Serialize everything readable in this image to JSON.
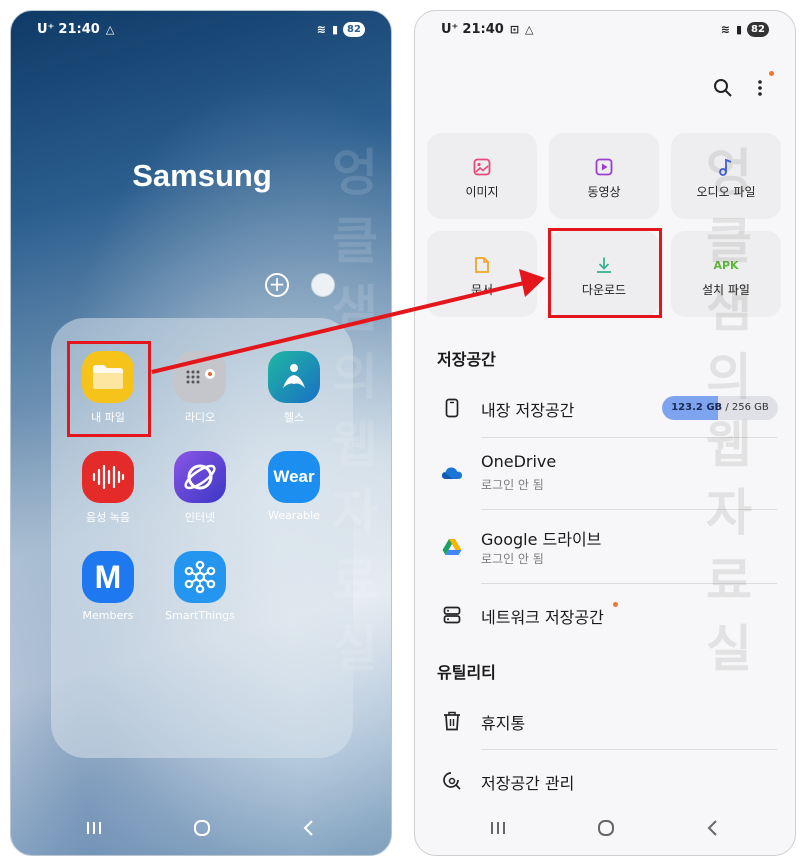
{
  "home": {
    "status": {
      "carrier": "U⁺",
      "time": "21:40",
      "battery": "82"
    },
    "brand": "Samsung",
    "apps": [
      {
        "label": "내 파일",
        "icon": "folder-icon"
      },
      {
        "label": "라디오",
        "icon": "radio-icon"
      },
      {
        "label": "헬스",
        "icon": "health-icon"
      },
      {
        "label": "음성 녹음",
        "icon": "voice-recorder-icon"
      },
      {
        "label": "인터넷",
        "icon": "internet-icon"
      },
      {
        "label": "Wearable",
        "icon": "wearable-icon",
        "glyph": "Wear"
      },
      {
        "label": "Members",
        "icon": "members-icon",
        "glyph": "M"
      },
      {
        "label": "SmartThings",
        "icon": "smartthings-icon"
      }
    ],
    "colors": {
      "highlight": "#e4161b",
      "folder_app": "#f6c31b",
      "radio_app": "#c4c6cc",
      "health_app": "#1fa6a8",
      "voice_app": "#e52a2a",
      "internet_app": "#6a4bd8",
      "wear_app": "#1c8ef0",
      "members_app": "#1e78f0",
      "smartthings_app": "#2496f0"
    }
  },
  "files": {
    "status": {
      "carrier": "U⁺",
      "time": "21:40",
      "battery": "82"
    },
    "categories": [
      {
        "label": "이미지",
        "icon": "image-icon",
        "color": "#e64a7b"
      },
      {
        "label": "동영상",
        "icon": "video-icon",
        "color": "#9b3fd2"
      },
      {
        "label": "오디오 파일",
        "icon": "music-icon",
        "color": "#3f5fd6"
      },
      {
        "label": "문서",
        "icon": "document-icon",
        "color": "#f0a621"
      },
      {
        "label": "다운로드",
        "icon": "download-icon",
        "color": "#33b38f"
      },
      {
        "label": "설치 파일",
        "icon": "apk-icon",
        "glyph": "APK",
        "color": "#5cb83a"
      }
    ],
    "storage_section": "저장공간",
    "storage": [
      {
        "title": "내장 저장공간",
        "icon": "phone-storage-icon",
        "used": "123.2 GB",
        "sep": " / ",
        "total": "256 GB",
        "used_fraction": 0.48
      },
      {
        "title": "OneDrive",
        "subtitle": "로그인 안 됨",
        "icon": "onedrive-icon"
      },
      {
        "title": "Google 드라이브",
        "subtitle": "로그인 안 됨",
        "icon": "google-drive-icon"
      },
      {
        "title": "네트워크 저장공간",
        "icon": "network-storage-icon"
      }
    ],
    "utility_section": "유틸리티",
    "utilities": [
      {
        "title": "휴지통",
        "icon": "trash-icon"
      },
      {
        "title": "저장공간 관리",
        "icon": "storage-manage-icon"
      }
    ]
  },
  "watermark": "엉클샘의웹자료실"
}
